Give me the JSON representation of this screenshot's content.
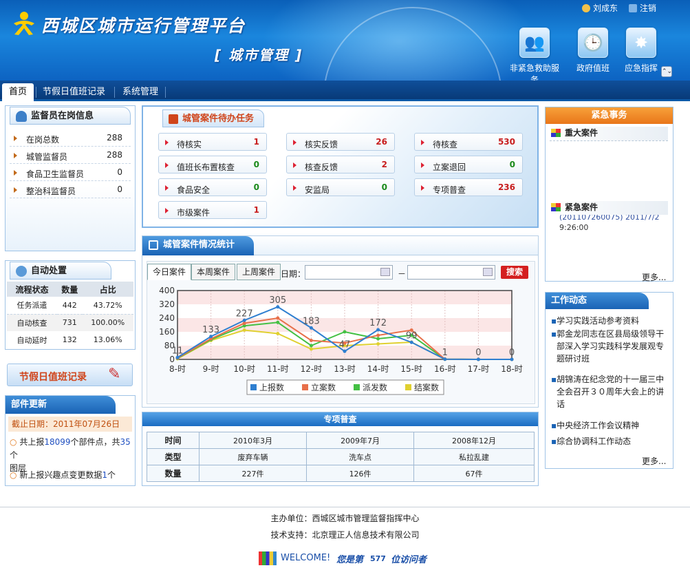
{
  "header": {
    "site_title": "西城区城市运行管理平台",
    "sub_title": "[ 城市管理 ]",
    "user_name": "刘成东",
    "logout": "注销",
    "buttons": [
      {
        "label": "非紧急救助服务",
        "icon": "people-icon"
      },
      {
        "label": "政府值班",
        "icon": "clock-icon"
      },
      {
        "label": "应急指挥",
        "icon": "alert-star-icon"
      }
    ]
  },
  "nav": {
    "tabs": [
      "首页",
      "节假日值班记录",
      "系统管理"
    ]
  },
  "supervisor": {
    "title": "监督员在岗信息",
    "items": [
      {
        "label": "在岗总数",
        "value": "288"
      },
      {
        "label": "城管监督员",
        "value": "288"
      },
      {
        "label": "食品卫生监督员",
        "value": "0"
      },
      {
        "label": "整治科监督员",
        "value": "0"
      }
    ]
  },
  "auto": {
    "title": "自动处置",
    "headers": [
      "流程状态",
      "数量",
      "占比"
    ],
    "rows": [
      [
        "任务派遣",
        "442",
        "43.72%"
      ],
      [
        "自动核查",
        "731",
        "100.00%"
      ],
      [
        "自动延时",
        "132",
        "13.06%"
      ]
    ]
  },
  "holiday_banner": "节假日值班记录",
  "parts": {
    "title": "部件更新",
    "date": "截止日期：2011年07月26日",
    "line1_a": "共上报",
    "line1_b": "18099",
    "line1_c": "个部件点，共",
    "line1_d": "35",
    "line1_e": "个",
    "line1_f": "图层",
    "line2_a": "新上报兴趣点变更数据",
    "line2_b": "1",
    "line2_c": "个"
  },
  "tasks": {
    "title": "城管案件待办任务",
    "items": [
      {
        "label": "待核实",
        "value": "1"
      },
      {
        "label": "核实反馈",
        "value": "26"
      },
      {
        "label": "待核查",
        "value": "530"
      },
      {
        "label": "值班长布置核查",
        "value": "0"
      },
      {
        "label": "核查反馈",
        "value": "2"
      },
      {
        "label": "立案退回",
        "value": "0"
      },
      {
        "label": "食品安全",
        "value": "0"
      },
      {
        "label": "安监局",
        "value": "0"
      },
      {
        "label": "专项普查",
        "value": "236"
      },
      {
        "label": "市级案件",
        "value": "1"
      }
    ]
  },
  "stats": {
    "title": "城管案件情况统计",
    "tabs": [
      "今日案件",
      "本周案件",
      "上周案件"
    ],
    "date_label": "日期：",
    "date_sep": "－",
    "search": "搜索"
  },
  "chart_data": {
    "type": "line",
    "categories": [
      "8-时",
      "9-时",
      "10-时",
      "11-时",
      "12-时",
      "13-时",
      "14-时",
      "15-时",
      "16-时",
      "17-时",
      "18-时"
    ],
    "ylim": [
      0,
      400
    ],
    "yticks": [
      "0",
      "80",
      "160",
      "240",
      "320",
      "400"
    ],
    "grid": true,
    "legend": "bottom",
    "series": [
      {
        "name": "上报数",
        "color": "#2f7fd0",
        "values": [
          11,
          133,
          227,
          305,
          183,
          47,
          172,
          99,
          1,
          0,
          0
        ]
      },
      {
        "name": "立案数",
        "color": "#e8704a",
        "values": [
          8,
          120,
          210,
          240,
          110,
          95,
          140,
          170,
          1,
          0,
          0
        ]
      },
      {
        "name": "派发数",
        "color": "#44c044",
        "values": [
          6,
          115,
          195,
          215,
          80,
          160,
          120,
          140,
          1,
          0,
          0
        ]
      },
      {
        "name": "结案数",
        "color": "#e0d030",
        "values": [
          4,
          110,
          170,
          150,
          60,
          80,
          90,
          100,
          1,
          0,
          0
        ]
      }
    ],
    "data_labels": [
      "11",
      "133",
      "227",
      "305",
      "183",
      "47",
      "172",
      "99",
      "1",
      "0",
      "0"
    ]
  },
  "survey": {
    "title": "专项普查",
    "rows": [
      [
        "时间",
        "2010年3月",
        "2009年7月",
        "2008年12月"
      ],
      [
        "类型",
        "废弃车辆",
        "洗车点",
        "私拉乱建"
      ],
      [
        "数量",
        "227件",
        "126件",
        "67件"
      ]
    ]
  },
  "urgent": {
    "title": "紧急事务",
    "major": "重大案件",
    "urgent_case": "紧急案件",
    "case_line1": "(201107260075) 2011/7/2",
    "case_line2": "9:26:00",
    "more": "更多..."
  },
  "work": {
    "title": "工作动态",
    "items": [
      "学习实践活动参考资料",
      "郭金龙同志在区县局级领导干部深入学习实践科学发展观专题研讨班",
      "胡锦涛在纪念党的十一届三中全会召开３０周年大会上的讲话",
      "中央经济工作会议精神",
      "综合协调科工作动态"
    ],
    "more": "更多..."
  },
  "footer": {
    "host": "主办单位：西城区城市管理监督指挥中心",
    "tech": "技术支持：北京理正人信息技术有限公司",
    "welcome_a": "WELCOME!",
    "welcome_b": "您是第",
    "count": "577",
    "welcome_c": "位访问者"
  }
}
